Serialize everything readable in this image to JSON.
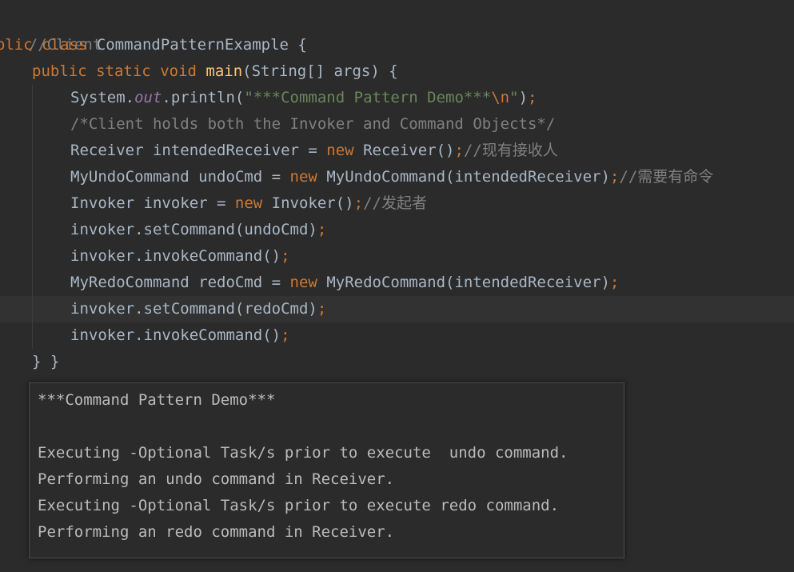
{
  "editor": {
    "comment_client": "//Client",
    "class_decl": {
      "kw_public": "public",
      "kw_class": "class",
      "class_name": "CommandPatternExample",
      "brace": " {"
    },
    "main_decl": {
      "kw_public": "public",
      "kw_static": "static",
      "kw_void": "void",
      "method": "main",
      "params": "(String[] args) {"
    },
    "println": {
      "prefix": "System.",
      "field": "out",
      "call": ".println(",
      "str_text": "\"***Command Pattern Demo***",
      "str_escape": "\\n",
      "str_end": "\"",
      "close": ")",
      "semi": ";"
    },
    "block_comment": "/*Client holds both the Invoker and Command Objects*/",
    "receiver_line": {
      "decl": "Receiver intendedReceiver = ",
      "kw_new": "new",
      "ctor": " Receiver()",
      "semi": ";",
      "comment_slashes": "//",
      "comment_text": "现有接收人"
    },
    "undo_line": {
      "decl": "MyUndoCommand undoCmd = ",
      "kw_new": "new",
      "ctor": " MyUndoCommand(intendedReceiver)",
      "semi": ";",
      "comment_slashes": "//",
      "comment_text": "需要有命令"
    },
    "invoker_line": {
      "decl": "Invoker invoker = ",
      "kw_new": "new",
      "ctor": " Invoker()",
      "semi": ";",
      "comment_slashes": "//",
      "comment_text": "发起者"
    },
    "set_undo": {
      "code": "invoker.setCommand(undoCmd)",
      "semi": ";"
    },
    "invoke_1": {
      "code": "invoker.invokeCommand()",
      "semi": ";"
    },
    "redo_line": {
      "decl": "MyRedoCommand redoCmd = ",
      "kw_new": "new",
      "ctor": " MyRedoCommand(intendedReceiver)",
      "semi": ";"
    },
    "set_redo": {
      "code": "invoker.setCommand(redoCmd)",
      "semi": ";"
    },
    "invoke_2": {
      "code": "invoker.invokeCommand()",
      "semi": ";"
    },
    "closing": "} }"
  },
  "console": {
    "lines": [
      "***Command Pattern Demo***",
      "",
      "Executing -Optional Task/s prior to execute  undo command.",
      "Performing an undo command in Receiver.",
      "Executing -Optional Task/s prior to execute redo command.",
      "Performing an redo command in Receiver."
    ]
  },
  "colors": {
    "background": "#2b2b2b",
    "keyword": "#cc7832",
    "method": "#ffc66d",
    "comment": "#808080",
    "string": "#6a8759",
    "static_field": "#9876aa",
    "text": "#a9b7c6"
  }
}
